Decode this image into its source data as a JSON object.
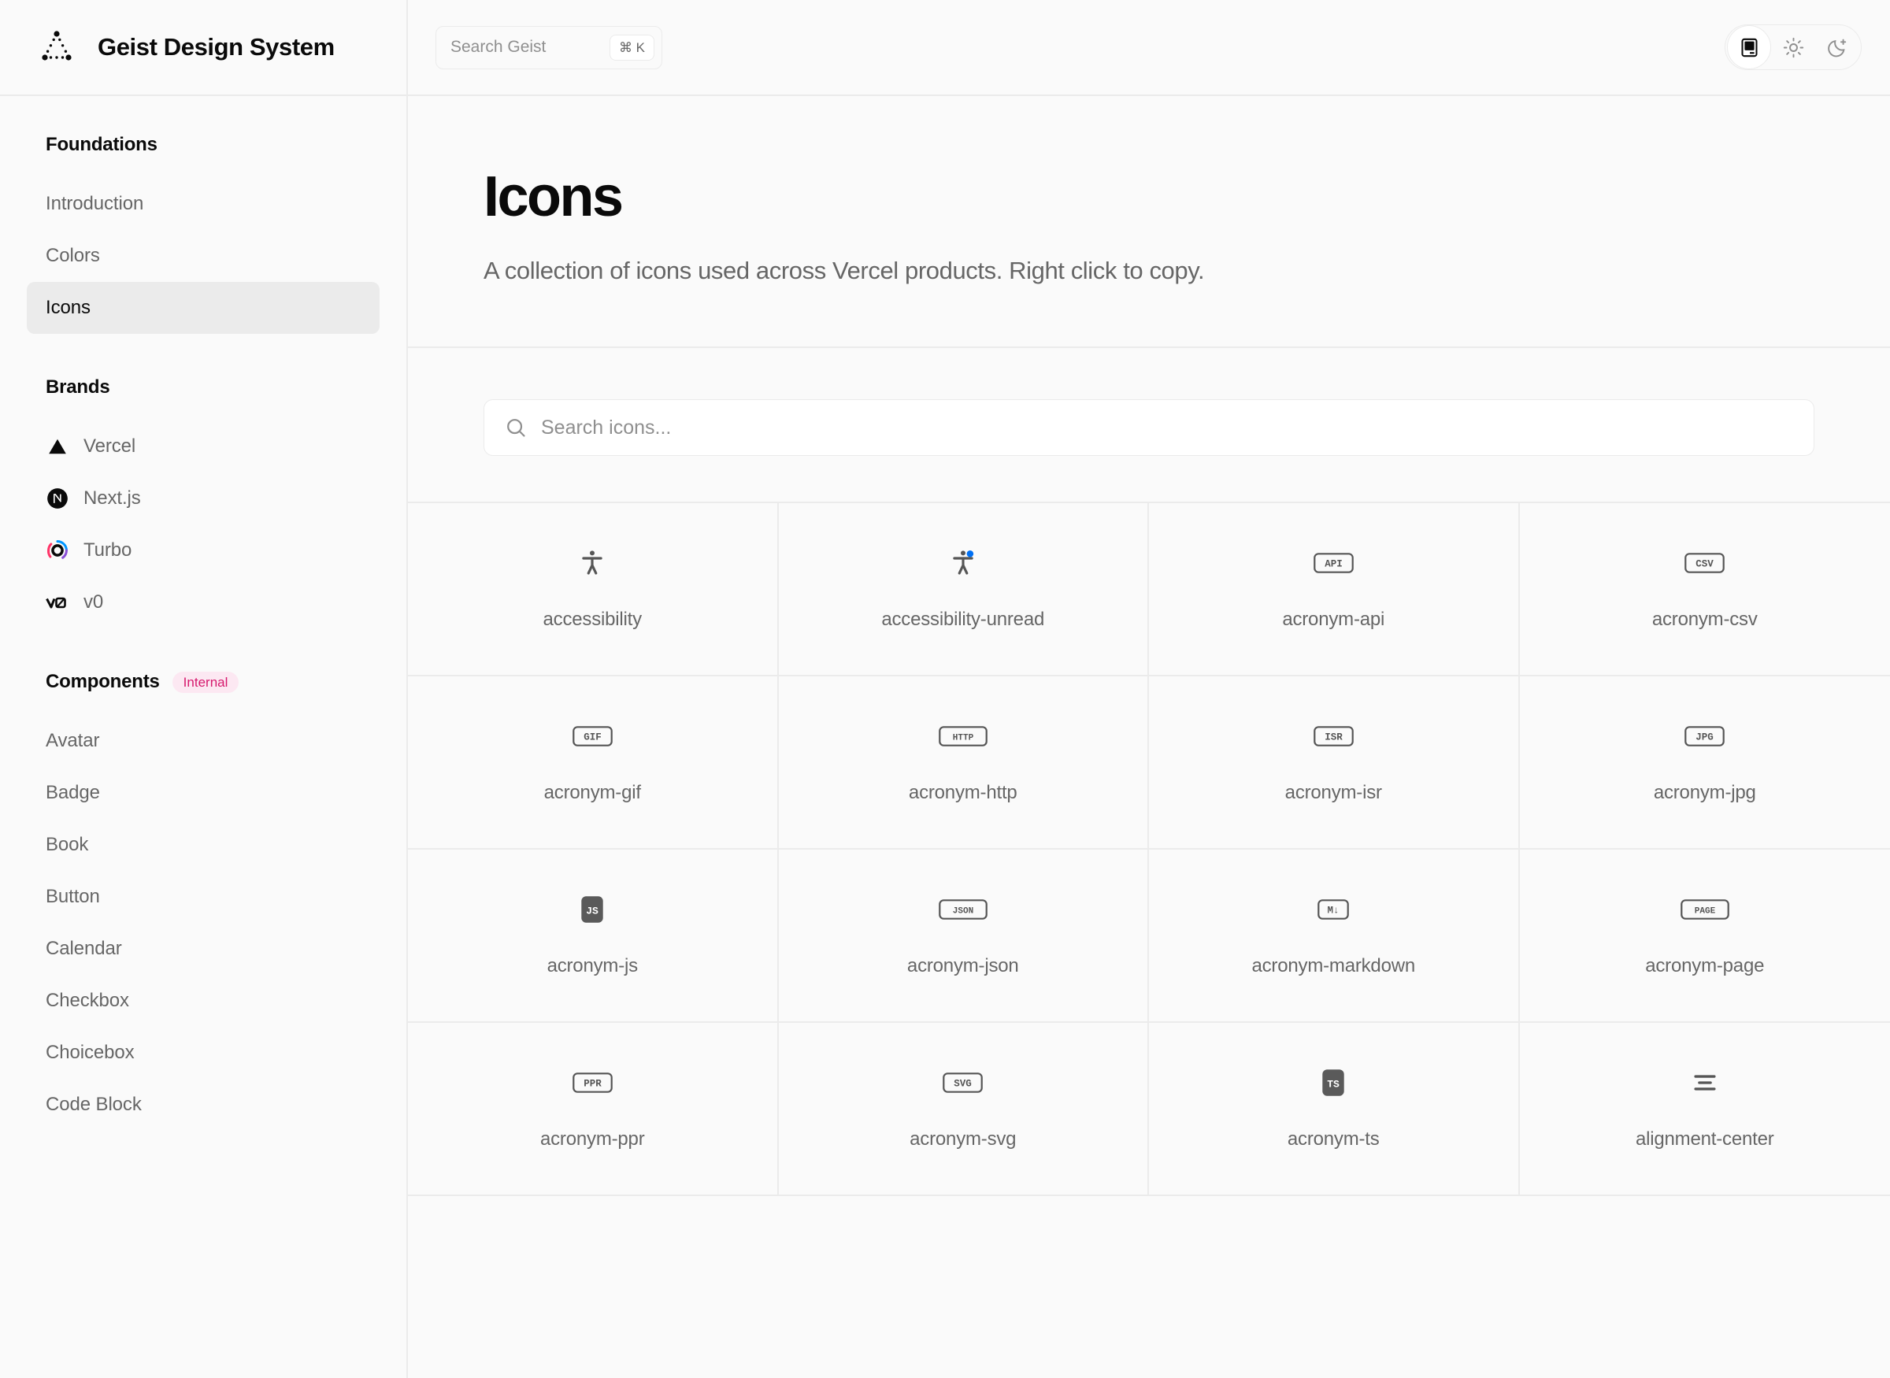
{
  "header": {
    "brand_title": "Geist Design System",
    "logo_icon": "geist-triangle-dotted-logo",
    "search": {
      "placeholder": "Search Geist",
      "shortcut": "⌘ K"
    },
    "theme_switcher": {
      "options": [
        {
          "name": "system",
          "icon": "monitor-icon",
          "active": true
        },
        {
          "name": "light",
          "icon": "sun-icon",
          "active": false
        },
        {
          "name": "dark",
          "icon": "moon-icon",
          "active": false
        }
      ]
    }
  },
  "sidebar": {
    "sections": [
      {
        "heading": "Foundations",
        "badge": null,
        "items": [
          {
            "label": "Introduction",
            "icon": null,
            "active": false
          },
          {
            "label": "Colors",
            "icon": null,
            "active": false
          },
          {
            "label": "Icons",
            "icon": null,
            "active": true
          }
        ]
      },
      {
        "heading": "Brands",
        "badge": null,
        "items": [
          {
            "label": "Vercel",
            "icon": "vercel-triangle-icon",
            "active": false
          },
          {
            "label": "Next.js",
            "icon": "nextjs-circle-icon",
            "active": false
          },
          {
            "label": "Turbo",
            "icon": "turbo-icon",
            "active": false
          },
          {
            "label": "v0",
            "icon": "v0-icon",
            "active": false
          }
        ]
      },
      {
        "heading": "Components",
        "badge": "Internal",
        "items": [
          {
            "label": "Avatar",
            "icon": null,
            "active": false
          },
          {
            "label": "Badge",
            "icon": null,
            "active": false
          },
          {
            "label": "Book",
            "icon": null,
            "active": false
          },
          {
            "label": "Button",
            "icon": null,
            "active": false
          },
          {
            "label": "Calendar",
            "icon": null,
            "active": false
          },
          {
            "label": "Checkbox",
            "icon": null,
            "active": false
          },
          {
            "label": "Choicebox",
            "icon": null,
            "active": false
          },
          {
            "label": "Code Block",
            "icon": null,
            "active": false
          }
        ]
      }
    ]
  },
  "page": {
    "title": "Icons",
    "description": "A collection of icons used across Vercel products. Right click to copy.",
    "search": {
      "placeholder": "Search icons...",
      "icon": "search-icon"
    }
  },
  "icon_grid": {
    "columns": 4,
    "items": [
      {
        "label": "accessibility",
        "icon": "accessibility-person-icon",
        "glyph_type": "person"
      },
      {
        "label": "accessibility-unread",
        "icon": "accessibility-unread-icon",
        "glyph_type": "person-dot",
        "dot_color": "#0070f3"
      },
      {
        "label": "acronym-api",
        "icon": "acronym-api-icon",
        "glyph_type": "badge-outline",
        "text": "API"
      },
      {
        "label": "acronym-csv",
        "icon": "acronym-csv-icon",
        "glyph_type": "badge-outline",
        "text": "CSV"
      },
      {
        "label": "acronym-gif",
        "icon": "acronym-gif-icon",
        "glyph_type": "badge-outline",
        "text": "GIF"
      },
      {
        "label": "acronym-http",
        "icon": "acronym-http-icon",
        "glyph_type": "badge-outline",
        "text": "HTTP"
      },
      {
        "label": "acronym-isr",
        "icon": "acronym-isr-icon",
        "glyph_type": "badge-outline",
        "text": "ISR"
      },
      {
        "label": "acronym-jpg",
        "icon": "acronym-jpg-icon",
        "glyph_type": "badge-outline",
        "text": "JPG"
      },
      {
        "label": "acronym-js",
        "icon": "acronym-js-icon",
        "glyph_type": "badge-filled",
        "text": "JS"
      },
      {
        "label": "acronym-json",
        "icon": "acronym-json-icon",
        "glyph_type": "badge-outline",
        "text": "JSON"
      },
      {
        "label": "acronym-markdown",
        "icon": "acronym-markdown-icon",
        "glyph_type": "badge-outline",
        "text": "M↓"
      },
      {
        "label": "acronym-page",
        "icon": "acronym-page-icon",
        "glyph_type": "badge-outline",
        "text": "PAGE"
      },
      {
        "label": "acronym-ppr",
        "icon": "acronym-ppr-icon",
        "glyph_type": "badge-outline",
        "text": "PPR"
      },
      {
        "label": "acronym-svg",
        "icon": "acronym-svg-icon",
        "glyph_type": "badge-outline",
        "text": "SVG"
      },
      {
        "label": "acronym-ts",
        "icon": "acronym-ts-icon",
        "glyph_type": "badge-filled",
        "text": "TS"
      },
      {
        "label": "alignment-center",
        "icon": "alignment-center-icon",
        "glyph_type": "align-center"
      }
    ]
  },
  "colors": {
    "background": "#fafafa",
    "border": "#ebebeb",
    "text_primary": "#0a0a0a",
    "text_secondary": "#666666",
    "text_placeholder": "#8f8f8f",
    "accent_blue": "#0070f3",
    "badge_internal_text": "#d6196d",
    "badge_internal_bg": "#fce8f2"
  }
}
